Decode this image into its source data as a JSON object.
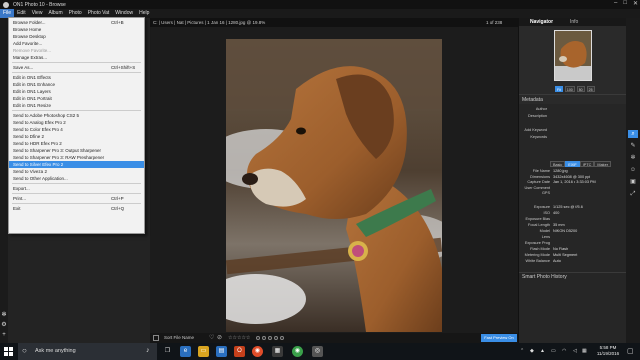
{
  "window": {
    "title": "ON1 Photo 10 - Browse"
  },
  "menubar": [
    "File",
    "Edit",
    "View",
    "Album",
    "Photo",
    "Photo Vat",
    "Window",
    "Help"
  ],
  "file_menu": [
    {
      "label": "Browse Folder...",
      "shortcut": "Ctrl+B"
    },
    {
      "label": "Browse Home",
      "shortcut": ""
    },
    {
      "label": "Browse Desktop",
      "shortcut": ""
    },
    {
      "label": "Add Favorite...",
      "shortcut": ""
    },
    {
      "label": "Remove Favorite...",
      "shortcut": "",
      "disabled": true
    },
    {
      "label": "Manage Extras...",
      "shortcut": ""
    },
    {
      "sep": true
    },
    {
      "label": "Save As...",
      "shortcut": "Ctrl+Shift+S"
    },
    {
      "sep": true
    },
    {
      "label": "Edit in ON1 Effects",
      "shortcut": ""
    },
    {
      "label": "Edit in ON1 Enhance",
      "shortcut": ""
    },
    {
      "label": "Edit in ON1 Layers",
      "shortcut": ""
    },
    {
      "label": "Edit in ON1 Portrait",
      "shortcut": ""
    },
    {
      "label": "Edit in ON1 Resize",
      "shortcut": ""
    },
    {
      "sep": true
    },
    {
      "label": "Send to Adobe Photoshop CS2 5",
      "shortcut": ""
    },
    {
      "label": "Send to Analog Efex Pro 2",
      "shortcut": ""
    },
    {
      "label": "Send to Color Efex Pro 4",
      "shortcut": ""
    },
    {
      "label": "Send to Dfine 2",
      "shortcut": ""
    },
    {
      "label": "Send to HDR Efex Pro 2",
      "shortcut": ""
    },
    {
      "label": "Send to Sharpener Pro 3: Output Sharpener",
      "shortcut": ""
    },
    {
      "label": "Send to Sharpener Pro 3: RAW Presharpener",
      "shortcut": ""
    },
    {
      "label": "Send to Silver Efex Pro 2",
      "shortcut": "",
      "highlighted": true
    },
    {
      "label": "Send to Viveza 2",
      "shortcut": ""
    },
    {
      "label": "Send to Other Application...",
      "shortcut": ""
    },
    {
      "sep": true
    },
    {
      "label": "Export...",
      "shortcut": ""
    },
    {
      "sep": true
    },
    {
      "label": "Print...",
      "shortcut": "Ctrl+P"
    },
    {
      "sep": true
    },
    {
      "label": "Exit",
      "shortcut": "Ctrl+Q"
    }
  ],
  "pathbar": {
    "path": "C: | Users | Nat | Pictures | 1 Jan 16 | 1280.jpg @ 19.8%",
    "count": "1 of 238"
  },
  "bottombar": {
    "sort_label": "Sort File Name",
    "stars": "☆☆☆☆☆",
    "fast_preview": "Fast Preview On"
  },
  "right_panel": {
    "tabs": [
      "Navigator",
      "Info"
    ],
    "zoom_buttons": [
      "Fit",
      "100",
      "50",
      "25"
    ],
    "metadata_header": "Metadata",
    "metadata_fields": [
      {
        "label": "Author",
        "value": ""
      },
      {
        "label": "Description",
        "value": ""
      },
      {
        "label": "Add Keyword",
        "value": ""
      },
      {
        "label": "Keywords",
        "value": ""
      }
    ],
    "meta_tabs": [
      "Basic",
      "EXIF",
      "IPTC",
      "Maker"
    ],
    "exif_top": [
      {
        "label": "File Name",
        "value": "1280.jpg"
      },
      {
        "label": "Dimensions",
        "value": "3432x4608 @ 300 ppi"
      },
      {
        "label": "Capture Date",
        "value": "Jan 1, 2016 • 3:33:03 PM"
      },
      {
        "label": "User Comment",
        "value": ""
      },
      {
        "label": "GPS",
        "value": ""
      }
    ],
    "exif_bottom": [
      {
        "label": "Exposure",
        "value": "1/125 sec @ f/5.6"
      },
      {
        "label": "ISO",
        "value": "400"
      },
      {
        "label": "Exposure Bias",
        "value": ""
      },
      {
        "label": "Focal Length",
        "value": "35 mm"
      },
      {
        "label": "Model",
        "value": "NIKON D5200"
      },
      {
        "label": "Lens",
        "value": ""
      },
      {
        "label": "Exposure Prog",
        "value": ""
      },
      {
        "label": "Flash Mode",
        "value": "No Flash"
      },
      {
        "label": "Metering Mode",
        "value": "Multi Segment"
      },
      {
        "label": "White Balance",
        "value": "Auto"
      }
    ],
    "history_header": "Smart Photo History"
  },
  "taskbar": {
    "search_placeholder": "Ask me anything",
    "time": "5:58 PM",
    "date": "11/19/2016"
  },
  "colors": {
    "accent": "#3a8ee6",
    "menu_highlight": "#3a8ee6"
  }
}
